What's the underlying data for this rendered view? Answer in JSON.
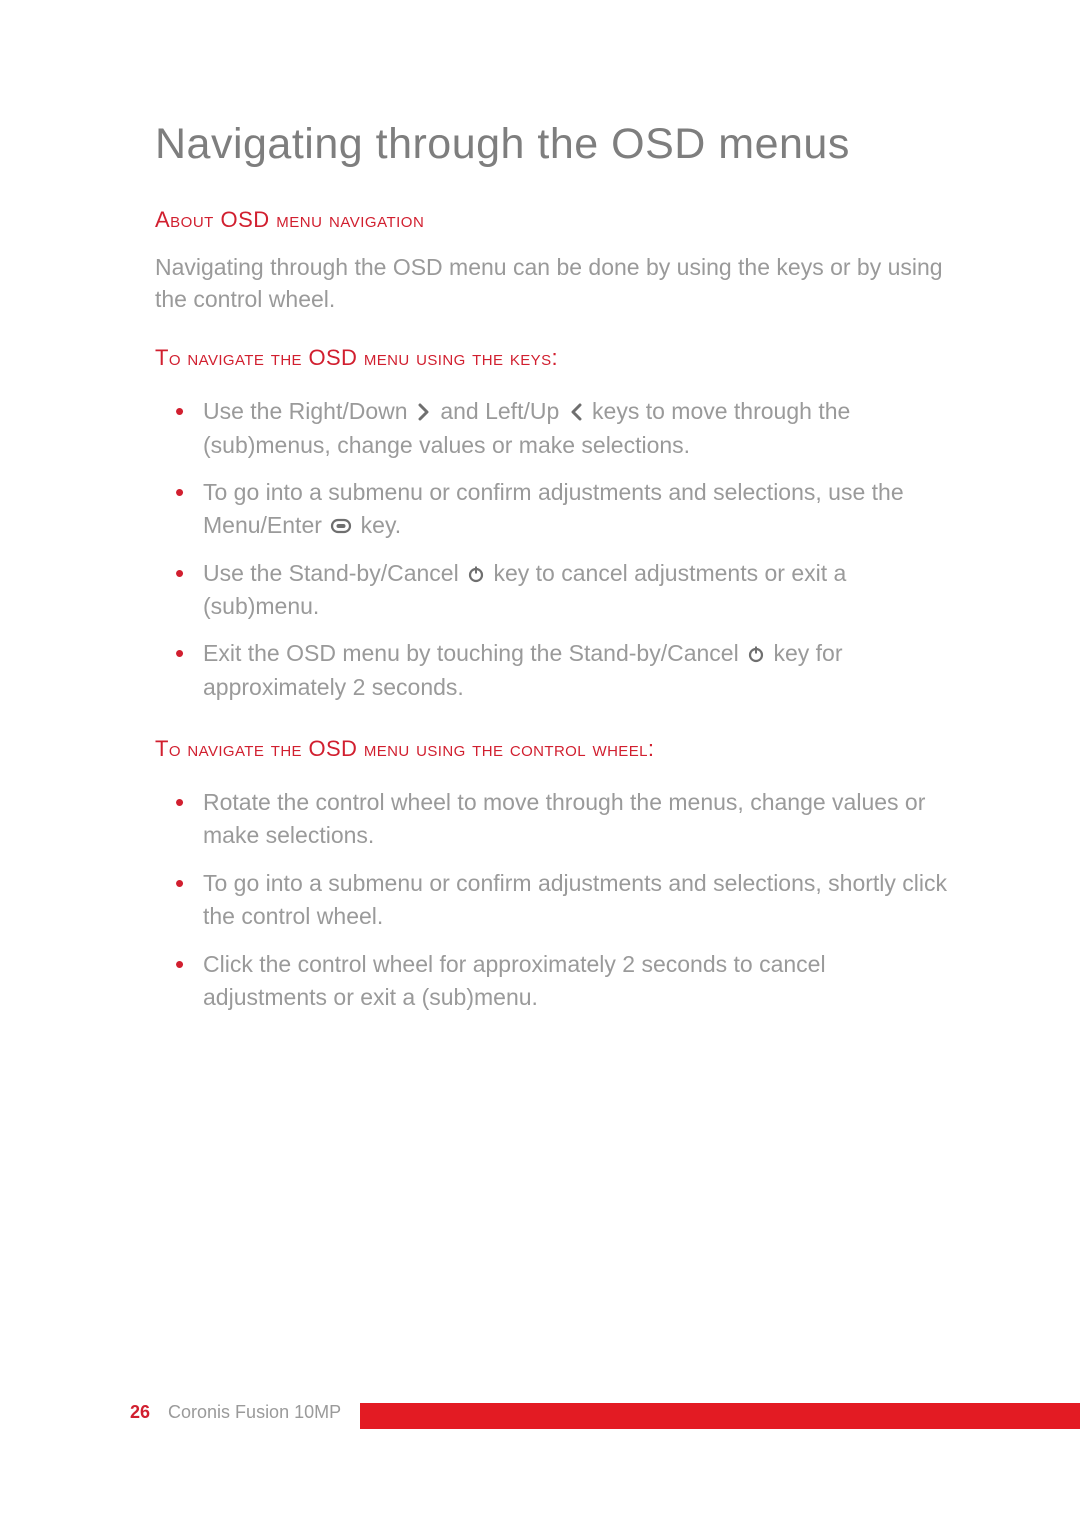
{
  "title": "Navigating through the OSD menus",
  "section1": {
    "heading": "About OSD menu navigation",
    "body": "Navigating through the OSD menu can be done by using the keys or by using the control wheel."
  },
  "keys": {
    "heading": "To navigate the OSD menu using the keys:",
    "items": [
      {
        "pre": "Use the Right/Down ",
        "icon": "chevron-right",
        "mid": " and Left/Up ",
        "icon2": "chevron-left",
        "post": " keys to move through the (sub)menus, change values or make selections."
      },
      {
        "pre": "To go into a submenu or confirm adjustments and selections, use the Menu/Enter ",
        "icon": "menu-enter",
        "post": " key."
      },
      {
        "pre": "Use the Stand-by/Cancel ",
        "icon": "power",
        "post": " key to cancel adjustments or exit a (sub)menu."
      },
      {
        "pre": "Exit the OSD menu by touching the Stand-by/Cancel ",
        "icon": "power",
        "post": " key for approximately 2 seconds."
      }
    ]
  },
  "wheel": {
    "heading": "To navigate the OSD menu using the control wheel:",
    "items": [
      "Rotate the control wheel to move through the menus, change values or make selections.",
      "To go into a submenu or confirm adjustments and selections, shortly click the control wheel.",
      "Click the control wheel for approximately 2 seconds to cancel adjustments or exit a (sub)menu."
    ]
  },
  "footer": {
    "page_number": "26",
    "product": "Coronis Fusion 10MP"
  }
}
